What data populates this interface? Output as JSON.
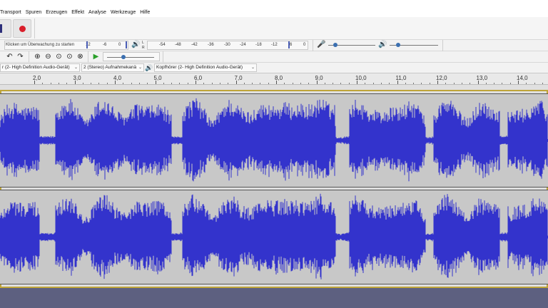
{
  "menu": {
    "items": [
      "Transport",
      "Spuren",
      "Erzeugen",
      "Effekt",
      "Analyse",
      "Werkzeuge",
      "Hilfe"
    ]
  },
  "meters": {
    "record_hint": "Klicken um Überwachung zu starten",
    "record_scale": [
      "12",
      "-6",
      "0"
    ],
    "playback_scale": [
      "-54",
      "-48",
      "-42",
      "-36",
      "-30",
      "-24",
      "-18",
      "-12",
      "-6",
      "0"
    ],
    "left_channel": "L",
    "right_channel": "R"
  },
  "devices": {
    "playback_host": "r (2- High Definition Audio-Gerät)",
    "channels": "2 (Stereo) Aufnahmekanä",
    "output": "Kopfhörer (2- High Definition Audio-Gerät)"
  },
  "timeline": {
    "labels": [
      "2,0",
      "3,0",
      "4,0",
      "5,0",
      "6,0",
      "7,0",
      "8,0",
      "9,0",
      "10,0",
      "11,0",
      "12,0",
      "13,0",
      "14,0"
    ]
  },
  "icons": {
    "pause": "pause-icon",
    "record": "record-icon",
    "speaker": "speaker-icon",
    "microphone": "microphone-icon",
    "undo": "undo-icon",
    "redo": "redo-icon",
    "zoom_in": "zoom-in-icon",
    "zoom_out": "zoom-out-icon",
    "fit_selection": "zoom-selection-icon",
    "fit_project": "zoom-fit-icon",
    "zoom_toggle": "zoom-toggle-icon",
    "play_at_speed": "play-at-speed-icon"
  },
  "colors": {
    "waveform": "#3333cc",
    "track_bg": "#c8c8c8",
    "selection_border": "#bfa53a",
    "record_red": "#d91e2a",
    "play_green": "#2aa02a"
  }
}
